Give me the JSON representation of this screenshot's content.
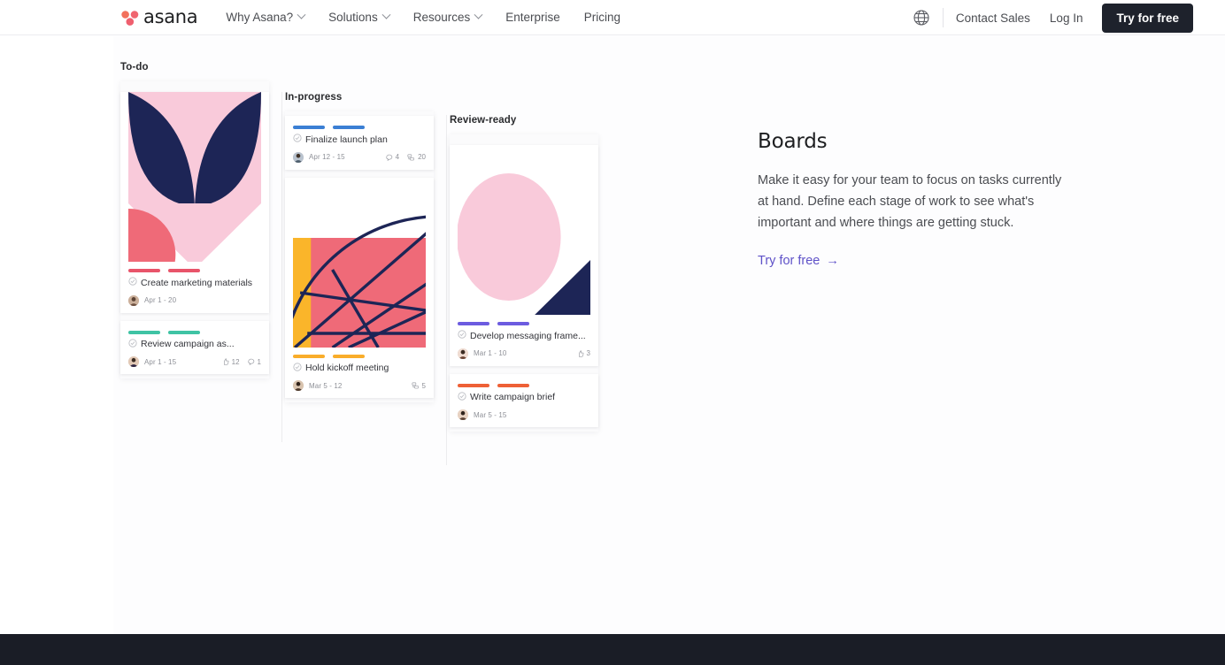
{
  "header": {
    "logo_text": "asana",
    "logo_icon": "asana-logo-dots",
    "nav": [
      {
        "label": "Why Asana?",
        "has_chevron": true
      },
      {
        "label": "Solutions",
        "has_chevron": true
      },
      {
        "label": "Resources",
        "has_chevron": true
      },
      {
        "label": "Enterprise",
        "has_chevron": false
      },
      {
        "label": "Pricing",
        "has_chevron": false
      }
    ],
    "globe_icon": "globe-icon",
    "contact_sales": "Contact Sales",
    "log_in": "Log In",
    "try_free": "Try for free"
  },
  "board": {
    "columns": [
      {
        "title": "To-do",
        "cards": [
          {
            "tag_color": "#e8546a",
            "title": "Create marketing materials",
            "dates": "Apr 1 - 20",
            "has_image": true,
            "image_name": "abstract-petal-artwork",
            "meta": []
          },
          {
            "tag_color": "#3fc3a4",
            "title": "Review campaign as...",
            "dates": "Apr 1 - 15",
            "has_image": false,
            "meta": [
              {
                "icon": "thumbs-up-icon",
                "value": "12"
              },
              {
                "icon": "comment-icon",
                "value": "1"
              }
            ]
          }
        ]
      },
      {
        "title": "In-progress",
        "cards": [
          {
            "tag_color": "#3b7fd4",
            "title": "Finalize launch plan",
            "dates": "Apr 12 - 15",
            "has_image": false,
            "meta": [
              {
                "icon": "comment-icon",
                "value": "4"
              },
              {
                "icon": "subtask-icon",
                "value": "20"
              }
            ]
          },
          {
            "tag_color": "#f9ad2a",
            "title": "Hold kickoff meeting",
            "dates": "Mar 5 - 12",
            "has_image": true,
            "image_name": "abstract-web-artwork",
            "meta": [
              {
                "icon": "subtask-icon",
                "value": "5"
              }
            ]
          }
        ]
      },
      {
        "title": "Review-ready",
        "cards": [
          {
            "tag_color": "#6c5ce0",
            "title": "Develop messaging frame...",
            "dates": "Mar 1 - 10",
            "has_image": true,
            "image_name": "abstract-circle-artwork",
            "meta": [
              {
                "icon": "thumbs-up-icon",
                "value": "3"
              }
            ]
          },
          {
            "tag_color": "#ee6036",
            "title": "Write campaign brief",
            "dates": "Mar 5 - 15",
            "has_image": false,
            "meta": []
          }
        ]
      }
    ]
  },
  "feature": {
    "heading": "Boards",
    "body": "Make it easy for your team to focus on tasks currently at hand. Define each stage of work to see what's important and where things are getting stuck.",
    "link_label": "Try for free",
    "link_arrow": "→"
  },
  "colors": {
    "cta_dark": "#1e222c",
    "accent_purple": "#5f52c8",
    "footer_dark": "#1a1d26",
    "navy": "#1d2556",
    "pink": "#f9cada",
    "coral": "#ef6a78",
    "yellow": "#fab52a"
  }
}
